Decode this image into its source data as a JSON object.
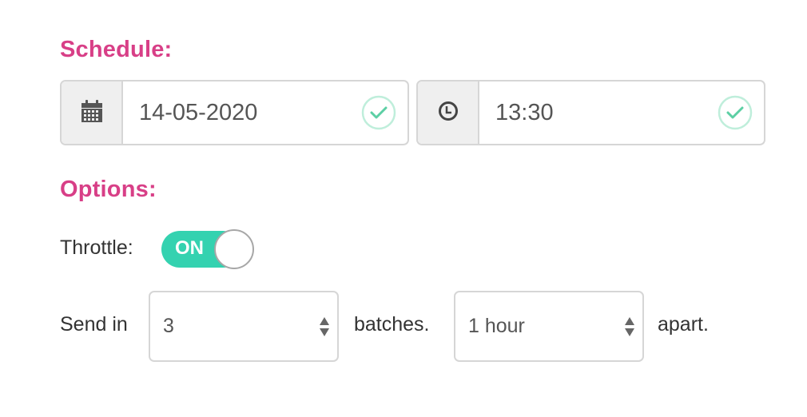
{
  "schedule": {
    "heading": "Schedule:",
    "date": {
      "icon": "calendar-icon",
      "value": "14-05-2020",
      "valid": true,
      "valid_icon": "check-circle-icon"
    },
    "time": {
      "icon": "clock-icon",
      "value": "13:30",
      "valid": true,
      "valid_icon": "check-circle-icon"
    }
  },
  "options": {
    "heading": "Options:",
    "throttle": {
      "label": "Throttle:",
      "state": "ON",
      "enabled": true
    },
    "send_in": {
      "prefix": "Send in",
      "batches_value": "3",
      "middle": "batches.",
      "interval_value": "1 hour",
      "suffix": "apart."
    }
  },
  "colors": {
    "heading": "#d83f87",
    "toggle_on": "#34d2b0",
    "valid_check": "#5ccfa4",
    "border": "#d6d6d6",
    "addon_bg": "#efefef"
  }
}
